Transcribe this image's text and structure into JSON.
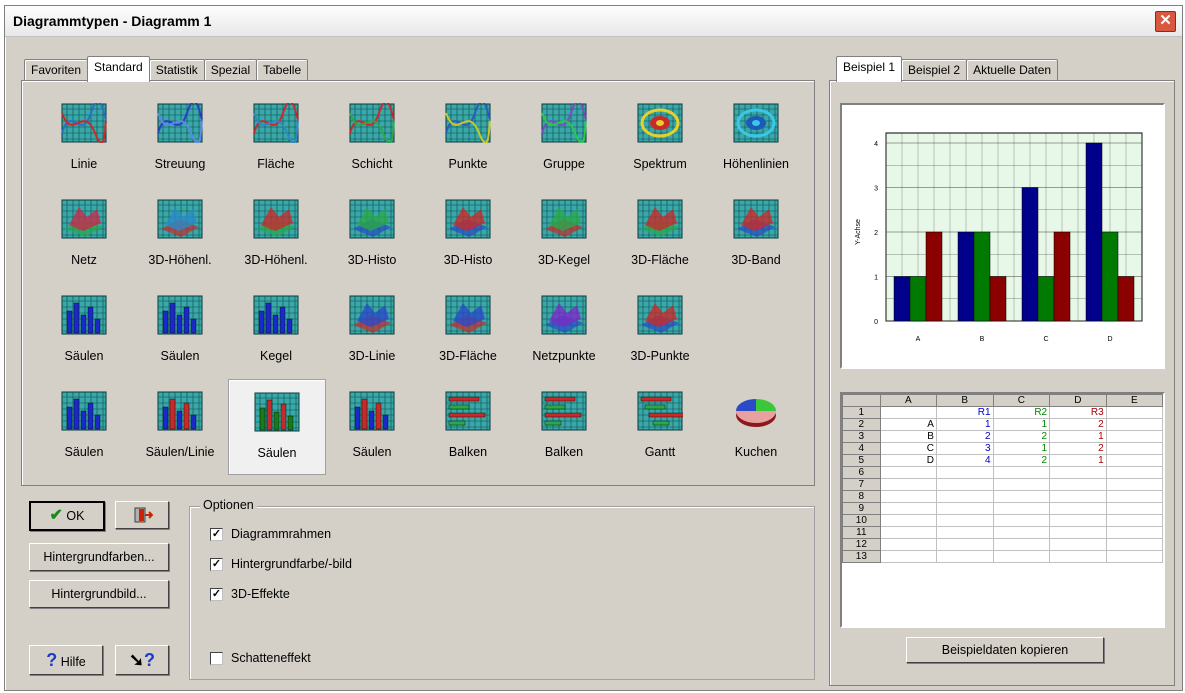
{
  "window": {
    "title": "Diagrammtypen - Diagramm 1",
    "close_glyph": "✕"
  },
  "left_tabs": [
    "Favoriten",
    "Standard",
    "Statistik",
    "Spezial",
    "Tabelle"
  ],
  "right_tabs": [
    "Beispiel 1",
    "Beispiel 2",
    "Aktuelle Daten"
  ],
  "chart_types": [
    {
      "label": "Linie",
      "icon": "line-chart-icon"
    },
    {
      "label": "Streuung",
      "icon": "scatter-chart-icon"
    },
    {
      "label": "Fläche",
      "icon": "area-chart-icon"
    },
    {
      "label": "Schicht",
      "icon": "layer-chart-icon"
    },
    {
      "label": "Punkte",
      "icon": "points-chart-icon"
    },
    {
      "label": "Gruppe",
      "icon": "group-chart-icon"
    },
    {
      "label": "Spektrum",
      "icon": "spectrum-chart-icon"
    },
    {
      "label": "Höhenlinien",
      "icon": "contour-chart-icon"
    },
    {
      "label": "Netz",
      "icon": "mesh-3d-icon"
    },
    {
      "label": "3D-Höhenl.",
      "icon": "contour-3d-icon"
    },
    {
      "label": "3D-Höhenl.",
      "icon": "contour-3d-alt-icon"
    },
    {
      "label": "3D-Histo",
      "icon": "histogram-3d-icon"
    },
    {
      "label": "3D-Histo",
      "icon": "histogram-3d-alt-icon"
    },
    {
      "label": "3D-Kegel",
      "icon": "cone-3d-icon"
    },
    {
      "label": "3D-Fläche",
      "icon": "surface-3d-icon"
    },
    {
      "label": "3D-Band",
      "icon": "ribbon-3d-icon"
    },
    {
      "label": "Säulen",
      "icon": "column-chart-icon"
    },
    {
      "label": "Säulen",
      "icon": "column-chart-alt-icon"
    },
    {
      "label": "Kegel",
      "icon": "cone-chart-icon"
    },
    {
      "label": "3D-Linie",
      "icon": "line-3d-icon"
    },
    {
      "label": "3D-Fläche",
      "icon": "area-3d-icon"
    },
    {
      "label": "Netzpunkte",
      "icon": "mesh-points-icon"
    },
    {
      "label": "3D-Punkte",
      "icon": "points-3d-icon"
    },
    {
      "label": "",
      "icon": ""
    },
    {
      "label": "Säulen",
      "icon": "column-3d-icon"
    },
    {
      "label": "Säulen/Linie",
      "icon": "column-line-icon"
    },
    {
      "label": "Säulen",
      "icon": "column-multi-icon"
    },
    {
      "label": "Säulen",
      "icon": "column-stacked-icon"
    },
    {
      "label": "Balken",
      "icon": "bar-chart-icon"
    },
    {
      "label": "Balken",
      "icon": "bar-stacked-icon"
    },
    {
      "label": "Gantt",
      "icon": "gantt-chart-icon"
    },
    {
      "label": "Kuchen",
      "icon": "pie-chart-icon"
    }
  ],
  "selected_index": 26,
  "buttons": {
    "ok": "OK",
    "background_colors": "Hintergrundfarben...",
    "background_image": "Hintergrundbild...",
    "help": "Hilfe",
    "copy_example": "Beispieldaten kopieren"
  },
  "options": {
    "legend": "Optionen",
    "items": [
      {
        "label": "Diagrammrahmen",
        "checked": true
      },
      {
        "label": "Hintergrundfarbe/-bild",
        "checked": true
      },
      {
        "label": "3D-Effekte",
        "checked": true
      },
      {
        "label": "Schatteneffekt",
        "checked": false
      }
    ]
  },
  "chart_data": {
    "type": "bar",
    "categories": [
      "A",
      "B",
      "C",
      "D"
    ],
    "series": [
      {
        "name": "R1",
        "values": [
          1,
          2,
          3,
          4
        ],
        "color": "#00008b"
      },
      {
        "name": "R2",
        "values": [
          1,
          2,
          1,
          2
        ],
        "color": "#007a00"
      },
      {
        "name": "R3",
        "values": [
          2,
          1,
          2,
          1
        ],
        "color": "#8b0000"
      }
    ],
    "ylabel": "Y-Achse",
    "ylim": [
      0,
      4
    ],
    "yticks": [
      "0",
      "1",
      "2",
      "3",
      "4"
    ],
    "grid": true
  },
  "sheet": {
    "col_headers": [
      "A",
      "B",
      "C",
      "D",
      "E"
    ],
    "row_numbers": [
      "1",
      "2",
      "3",
      "4",
      "5",
      "6",
      "7",
      "8",
      "9",
      "10",
      "11",
      "12",
      "13"
    ],
    "rows": [
      [
        "",
        "R1",
        "R2",
        "R3",
        ""
      ],
      [
        "A",
        "1",
        "1",
        "2",
        ""
      ],
      [
        "B",
        "2",
        "2",
        "1",
        ""
      ],
      [
        "C",
        "3",
        "1",
        "2",
        ""
      ],
      [
        "D",
        "4",
        "2",
        "1",
        ""
      ]
    ],
    "colors": [
      "#000000",
      "#0000cc",
      "#008800",
      "#aa0000",
      "#000000"
    ]
  }
}
